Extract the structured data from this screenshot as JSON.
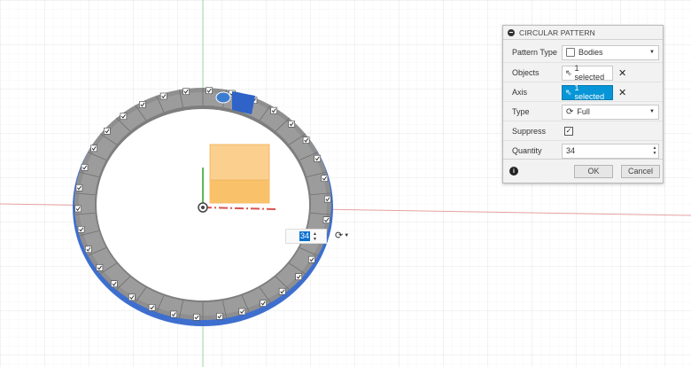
{
  "dialog": {
    "title": "CIRCULAR PATTERN",
    "rows": {
      "pattern_type": {
        "label": "Pattern Type",
        "value": "Bodies"
      },
      "objects": {
        "label": "Objects",
        "value": "1 selected"
      },
      "axis": {
        "label": "Axis",
        "value": "1 selected"
      },
      "type": {
        "label": "Type",
        "value": "Full"
      },
      "suppress": {
        "label": "Suppress",
        "checked": true
      },
      "quantity": {
        "label": "Quantity",
        "value": "34"
      }
    },
    "buttons": {
      "ok": "OK",
      "cancel": "Cancel"
    }
  },
  "canvas": {
    "quantity_value": "34",
    "pattern_count": 34,
    "icons": [
      "rotate-icon",
      "dropdown-icon",
      "info-icon",
      "close-icon",
      "cursor-icon"
    ]
  },
  "colors": {
    "accent": "#0696d7",
    "ring": "#8f8f8f",
    "selected_body": "#3e6fcf",
    "axis_red": "#d9534f",
    "axis_green": "#5cb85c",
    "cube": "#f8c16a"
  }
}
